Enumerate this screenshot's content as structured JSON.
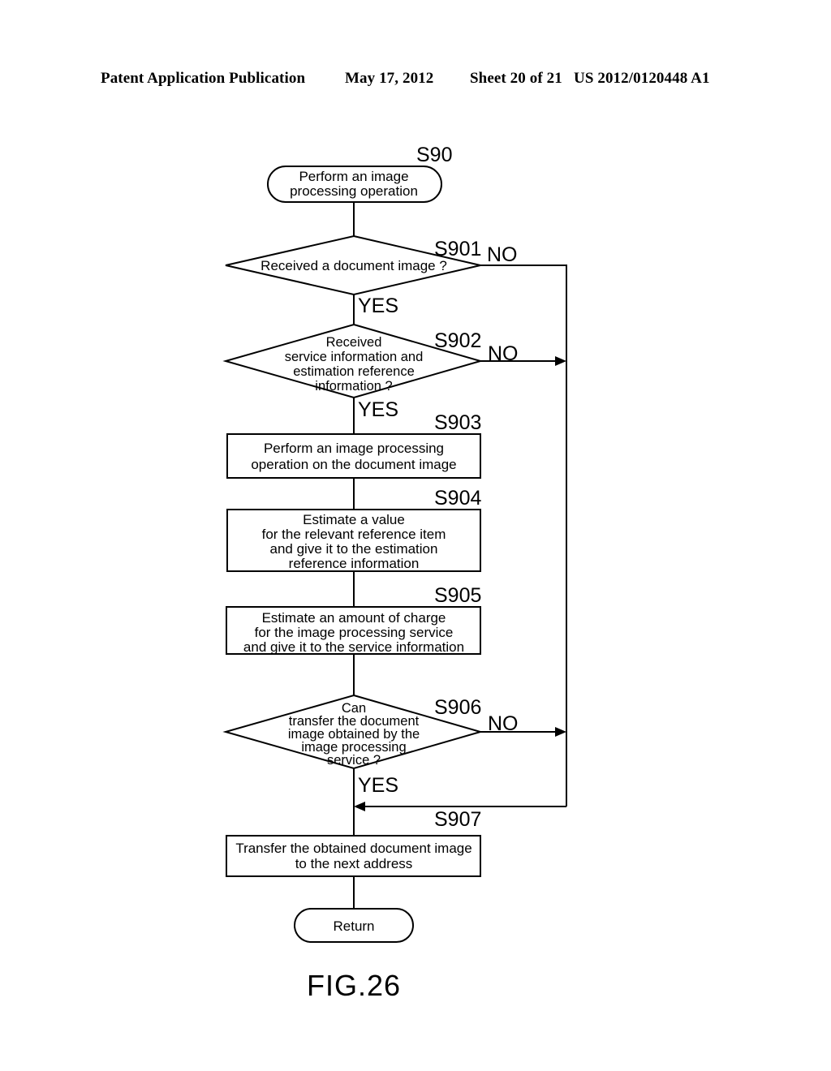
{
  "header": {
    "publication": "Patent Application Publication",
    "date": "May 17, 2012",
    "sheet": "Sheet 20 of 21",
    "number": "US 2012/0120448 A1"
  },
  "figure": {
    "caption": "FIG.26"
  },
  "flowchart": {
    "start": {
      "step": "S90",
      "line1": "Perform an image",
      "line2": "processing operation"
    },
    "d901": {
      "step": "S901",
      "line1": "Received a document image ?",
      "no": "NO",
      "yes": "YES"
    },
    "d902": {
      "step": "S902",
      "line1": "Received",
      "line2": "service information and",
      "line3": "estimation reference",
      "line4": "information ?",
      "no": "NO",
      "yes": "YES"
    },
    "p903": {
      "step": "S903",
      "line1": "Perform an image processing",
      "line2": "operation on the document image"
    },
    "p904": {
      "step": "S904",
      "line1": "Estimate a value",
      "line2": "for the relevant reference item",
      "line3": "and give it to the estimation",
      "line4": "reference information"
    },
    "p905": {
      "step": "S905",
      "line1": "Estimate an amount of charge",
      "line2": "for the image processing service",
      "line3": "and give it to the service information"
    },
    "d906": {
      "step": "S906",
      "line1": "Can",
      "line2": "transfer the document",
      "line3": "image obtained  by the",
      "line4": "image processing",
      "line5": "service ?",
      "no": "NO",
      "yes": "YES"
    },
    "p907": {
      "step": "S907",
      "line1": "Transfer the obtained document image",
      "line2": "to the next address"
    },
    "end": {
      "label": "Return"
    }
  },
  "chart_data": {
    "type": "diagram",
    "title": "FIG.26",
    "nodes": [
      {
        "id": "S90",
        "kind": "terminal",
        "text": "Perform an image processing operation"
      },
      {
        "id": "S901",
        "kind": "decision",
        "text": "Received a document image ?"
      },
      {
        "id": "S902",
        "kind": "decision",
        "text": "Received service information and estimation reference information ?"
      },
      {
        "id": "S903",
        "kind": "process",
        "text": "Perform an image processing operation on the document image"
      },
      {
        "id": "S904",
        "kind": "process",
        "text": "Estimate a value for the relevant reference item and give it to the estimation reference information"
      },
      {
        "id": "S905",
        "kind": "process",
        "text": "Estimate an amount of charge for the image processing service and give it to the service information"
      },
      {
        "id": "S906",
        "kind": "decision",
        "text": "Can transfer the document image obtained by the image processing service ?"
      },
      {
        "id": "S907",
        "kind": "process",
        "text": "Transfer the obtained document image to the next address"
      },
      {
        "id": "END",
        "kind": "terminal",
        "text": "Return"
      }
    ],
    "edges": [
      {
        "from": "S90",
        "to": "S901",
        "label": ""
      },
      {
        "from": "S901",
        "to": "S902",
        "label": "YES"
      },
      {
        "from": "S901",
        "to": "END-MERGE",
        "label": "NO"
      },
      {
        "from": "S902",
        "to": "S903",
        "label": "YES"
      },
      {
        "from": "S902",
        "to": "END-MERGE",
        "label": "NO"
      },
      {
        "from": "S903",
        "to": "S904",
        "label": ""
      },
      {
        "from": "S904",
        "to": "S905",
        "label": ""
      },
      {
        "from": "S905",
        "to": "S906",
        "label": ""
      },
      {
        "from": "S906",
        "to": "S907",
        "label": "YES"
      },
      {
        "from": "S906",
        "to": "END-MERGE",
        "label": "NO"
      },
      {
        "from": "S907",
        "to": "END",
        "label": ""
      }
    ]
  }
}
